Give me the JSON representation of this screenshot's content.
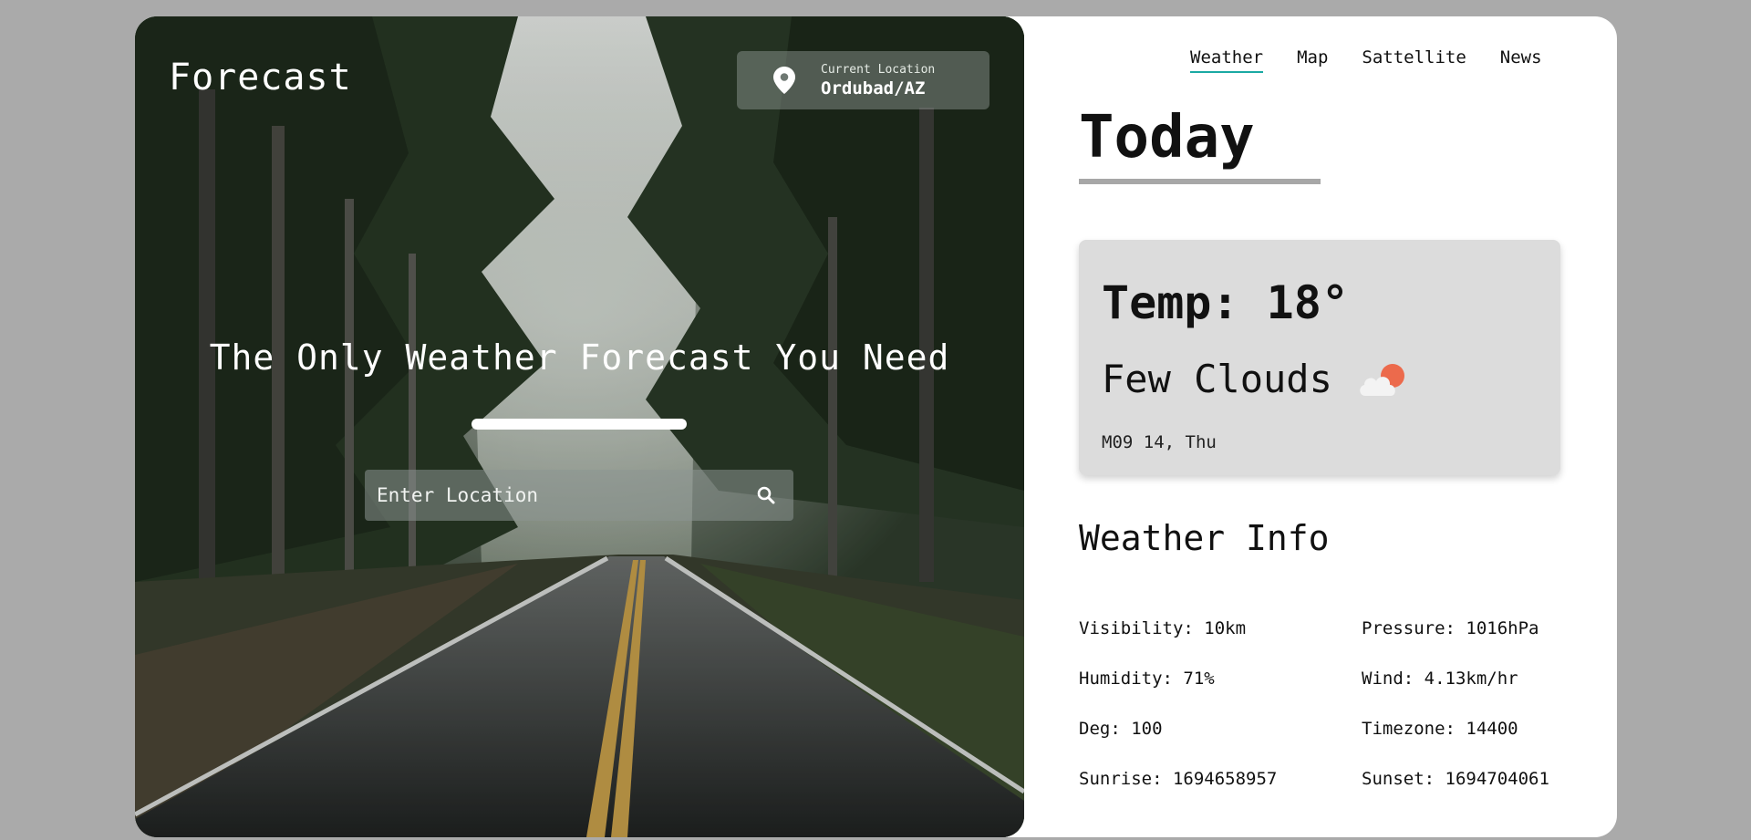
{
  "hero": {
    "logo": "Forecast",
    "current_location_label": "Current Location",
    "current_location": "Ordubad/AZ",
    "headline": "The Only Weather Forecast You Need",
    "search_placeholder": "Enter Location"
  },
  "nav": {
    "items": [
      "Weather",
      "Map",
      "Sattellite",
      "News"
    ],
    "active": "Weather"
  },
  "today": {
    "title": "Today",
    "temp": "Temp: 18°",
    "condition": "Few Clouds",
    "date": "M09 14, Thu",
    "icon": "few-clouds-icon"
  },
  "info": {
    "title": "Weather Info",
    "visibility": "Visibility: 10km",
    "pressure": "Pressure: 1016hPa",
    "humidity": "Humidity: 71%",
    "wind": "Wind: 4.13km/hr",
    "deg": "Deg: 100",
    "timezone": "Timezone: 14400",
    "sunrise": "Sunrise: 1694658957",
    "sunset": "Sunset: 1694704061"
  },
  "colors": {
    "accent": "#1aa9a3",
    "page_bg": "#aaaaaa",
    "card_bg": "#dcdcdc"
  }
}
